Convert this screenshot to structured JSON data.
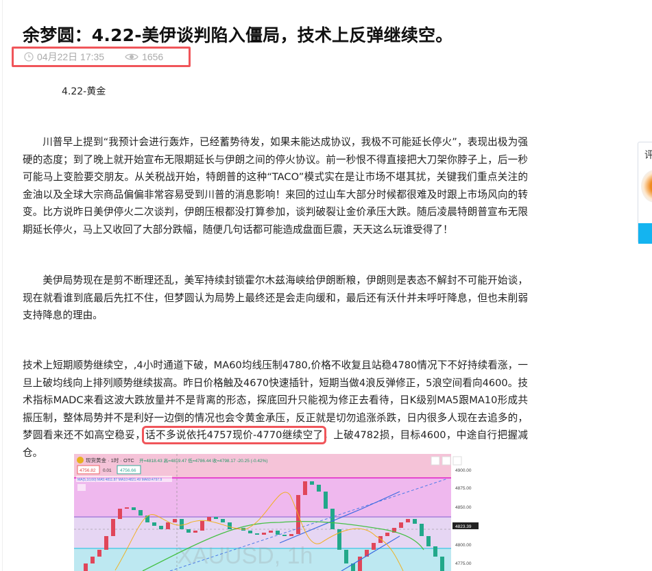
{
  "article": {
    "title": "余梦圆：4.22-美伊谈判陷入僵局，技术上反弹继续空。",
    "date": "04月22日 17:35",
    "views": "1656",
    "subtitle": "4.22-黄金",
    "paragraphs": [
      "川普早上提到“我预计会进行轰炸，已经蓄势待发，如果未能达成协议，我极不可能延长停火”，表现出极为强硬的态度；到了晚上就开始宣布无限期延长与伊朗之间的停火协议。前一秒恨不得直接把大刀架你脖子上，后一秒可能马上变脸要交朋友。从关税战开始，特朗普的这种“TACO”模式实在是让市场不堪其扰，关键我们重点关注的金油以及全球大宗商品偏偏非常容易受到川普的消息影响！来回的过山车大部分时候都很难及时跟上市场风向的转变。比方说昨日美伊停火二次谈判，伊朗压根都没打算参加，谈判破裂让金价承压大跌。随后凌晨特朗普宣布无限期延长停火，马上又收回了大部分跌幅，随便几句话都可能造成盘面巨震，天天这么玩谁受得了！",
      "美伊局势现在是剪不断理还乱，美军持续封锁霍尔木兹海峡给伊朗断粮，伊朗则是表态不解封不可能开始谈，现在就看谁到底最后先扛不住，但梦圆认为局势上最终还是会走向缓和，最后还有沃什并未呼吁降息，但也未削弱支持降息的理由。"
    ],
    "tech_paragraph": {
      "before": "技术上短期顺势继续空，,4小时通道下破，MA60均线压制4780,价格不收复且站稳4780情况下不好持续看涨，一旦上破均线向上排列顺势继续拔高。昨日价格触及4670快速插针，短期当做4浪反弹修正，5浪空间看向4600。技术指标MADC来看这波大跌放量并不是背离的形态，探底回升只能视为修正去看待，日K级别MA5跟MA10形成共振压制，整体局势并不是利好一边倒的情况也会令黄金承压，反正就是切勿追涨杀跌，日内很多人现在去追多的，梦圆看来还不如高空稳妥，",
      "highlight": "话不多说依托4757现价-4770继续空了",
      "after": "，上破4782损，目标4600，中途自行把握减仓。"
    }
  },
  "chart_image": {
    "symbol": "现货黄金 · 1时 · OTC",
    "ohlc": "开=4818.43 高=4819.47 低=4786.44 收=4798.17 -20.25 (-0.42%)",
    "sell": "4756.82",
    "spread": "0.01",
    "buy": "4756.66",
    "ma_label": "MA(5,10,60) MA5:4811.87 MA10:4821.49 MA60:4797.9",
    "watermark": "XAUUSD, 1h",
    "price_ticks": [
      "4900.00",
      "4875.00",
      "4850.00",
      "4800.00",
      "4775.00"
    ],
    "current_price": "4823.39"
  },
  "side_widget": {
    "label": "评"
  }
}
